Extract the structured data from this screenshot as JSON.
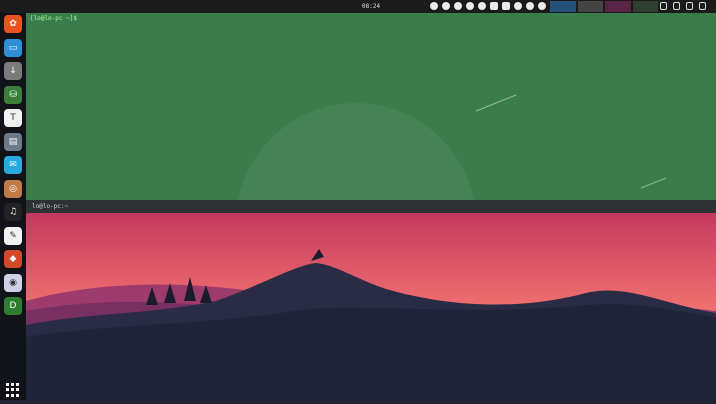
{
  "topbar": {
    "clock": "08:24"
  },
  "terminal": {
    "prompt": "[lo@lo-pc ~]$",
    "tab_title": "lo@lo-pc:~"
  },
  "dock": {
    "items": [
      {
        "name": "ubuntu-software-icon",
        "color": "#e95420",
        "glyph": "✿"
      },
      {
        "name": "files-icon",
        "color": "#2d8fd5",
        "glyph": "▭"
      },
      {
        "name": "download-icon",
        "color": "#7b7b7b",
        "glyph": "↓"
      },
      {
        "name": "app-icon",
        "color": "#3a7e3a",
        "glyph": "⛁"
      },
      {
        "name": "typora-icon",
        "color": "#f2f2f2",
        "glyph": "T"
      },
      {
        "name": "folder-icon",
        "color": "#6c7a8a",
        "glyph": "▤"
      },
      {
        "name": "chat-icon",
        "color": "#2aa9e0",
        "glyph": "✉"
      },
      {
        "name": "tool-icon",
        "color": "#c07a4a",
        "glyph": "◎"
      },
      {
        "name": "headphones-icon",
        "color": "#222",
        "glyph": "♫"
      },
      {
        "name": "browser-icon",
        "color": "#f2f2f2",
        "glyph": "✎"
      },
      {
        "name": "gitkraken-icon",
        "color": "#d04a2a",
        "glyph": "◆"
      },
      {
        "name": "settings-icon",
        "color": "#cfcfe8",
        "glyph": "◉"
      },
      {
        "name": "d-app-icon",
        "color": "#2e7d32",
        "glyph": "D"
      }
    ]
  }
}
